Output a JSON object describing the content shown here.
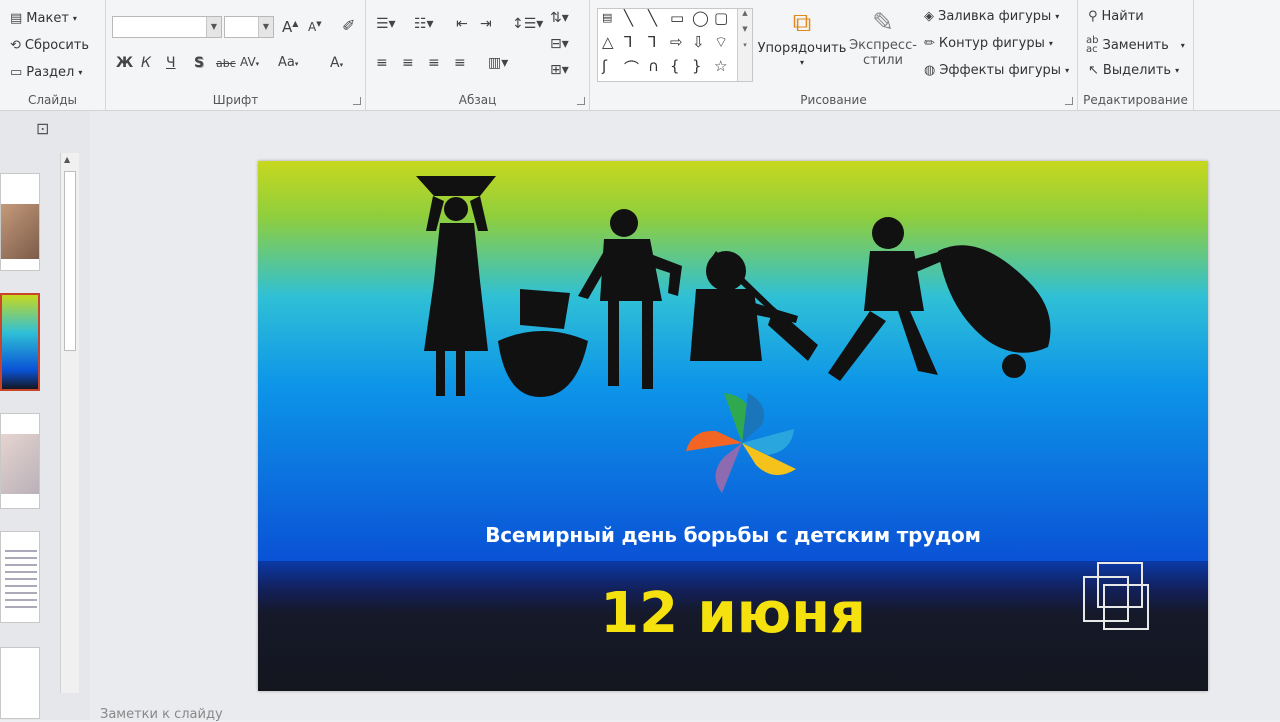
{
  "ribbon": {
    "slides_group": {
      "label": "Слайды",
      "layout": "Макет",
      "reset": "Сбросить",
      "section": "Раздел"
    },
    "font_group": {
      "label": "Шрифт",
      "font_name": "",
      "font_size": "",
      "bold": "Ж",
      "italic": "К",
      "underline": "Ч",
      "shadow": "S",
      "strike": "abc",
      "spacing": "AV",
      "case": "Aa",
      "grow": "A",
      "shrink": "A",
      "color": "A"
    },
    "paragraph_group": {
      "label": "Абзац"
    },
    "drawing_group": {
      "label": "Рисование",
      "arrange": "Упорядочить",
      "quick_styles_1": "Экспресс-",
      "quick_styles_2": "стили",
      "fill": "Заливка фигуры",
      "outline": "Контур фигуры",
      "effects": "Эффекты фигуры"
    },
    "editing_group": {
      "label": "Редактирование",
      "find": "Найти",
      "replace": "Заменить",
      "select": "Выделить"
    }
  },
  "slide": {
    "caption": "Всемирный день борьбы с детским трудом",
    "date": "12 июня"
  },
  "notes_label": "Заметки к слайду"
}
